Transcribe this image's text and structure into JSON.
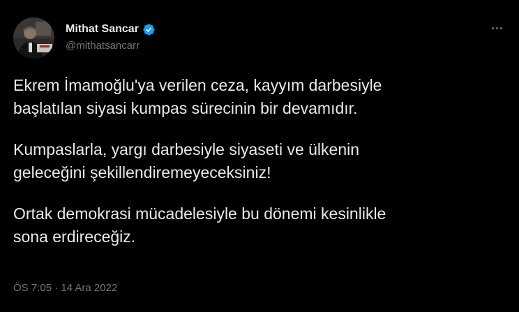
{
  "author": {
    "name": "Mithat Sancar",
    "handle": "@mithatsancarr",
    "verified": true
  },
  "tweet": {
    "paragraphs": [
      [
        "Ekrem İmamoğlu'ya verilen ceza, kayyım darbesiyle",
        "başlatılan siyasi kumpas sürecinin bir devamıdır."
      ],
      [
        "Kumpaslarla, yargı darbesiyle siyaseti ve ülkenin",
        "geleceğini şekillendiremeyeceksiniz!"
      ],
      [
        "Ortak demokrasi mücadelesiyle bu dönemi kesinlikle",
        "sona erdireceğiz."
      ]
    ],
    "time": "ÖS 7:05",
    "separator": " · ",
    "date": "14 Ara 2022"
  },
  "icons": {
    "verified": "verified-badge-icon",
    "more": "more-options-icon"
  },
  "colors": {
    "background": "#000000",
    "text": "#e7e9ea",
    "secondary": "#71767b",
    "accent": "#1d9bf0"
  }
}
